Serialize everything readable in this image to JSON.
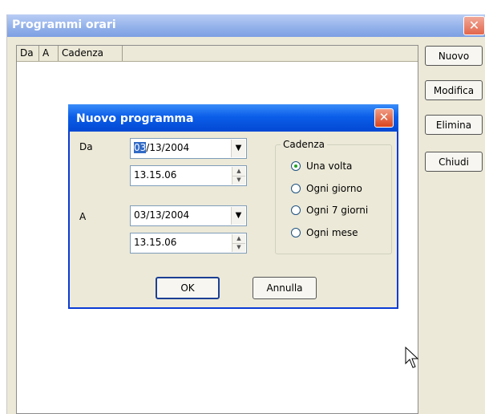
{
  "main_window": {
    "title": "Programmi orari",
    "close_glyph": "✕",
    "columns": [
      "Da",
      "A",
      "Cadenza"
    ],
    "buttons": {
      "new_label": "Nuovo",
      "edit_label": "Modifica",
      "delete_label": "Elimina",
      "close_label": "Chiudi"
    }
  },
  "dialog": {
    "title": "Nuovo programma",
    "close_glyph": "✕",
    "from": {
      "label": "Da",
      "date_selected": "03",
      "date_rest": "/13/2004",
      "time": "13.15.06"
    },
    "to": {
      "label": "A",
      "date": "03/13/2004",
      "time": "13.15.06"
    },
    "frequency": {
      "group_label": "Cadenza",
      "options": [
        "Una volta",
        "Ogni giorno",
        "Ogni 7 giorni",
        "Ogni mese"
      ],
      "selected": "Una volta"
    },
    "ok_label": "OK",
    "cancel_label": "Annulla"
  },
  "icons": {
    "dropdown": "▼",
    "spin_up": "▲",
    "spin_down": "▼"
  },
  "colors": {
    "title_active": "#0b5ee9",
    "title_inactive": "#94b2ea",
    "window_bg": "#ece9d8",
    "close_red": "#d9441e"
  }
}
